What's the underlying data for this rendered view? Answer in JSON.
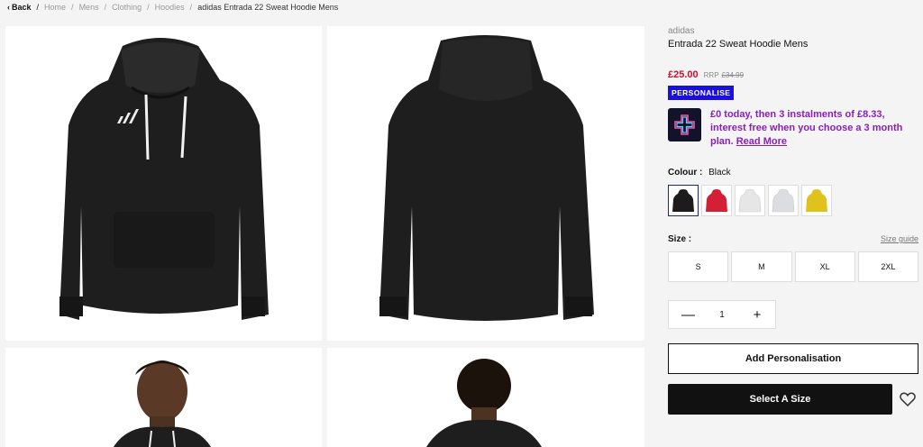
{
  "breadcrumb": {
    "back": "Back",
    "items": [
      "Home",
      "Mens",
      "Clothing",
      "Hoodies"
    ],
    "current": "adidas Entrada 22 Sweat Hoodie Mens"
  },
  "product": {
    "brand": "adidas",
    "name": "Entrada 22 Sweat Hoodie Mens",
    "price": "£25.00",
    "rrp_label": "RRP",
    "rrp_value": "£34.99",
    "personalise_badge": "PERSONALISE",
    "klarna_text": "£0 today, then 3 instalments of £8.33, interest free when you choose a 3 month plan.",
    "klarna_link": "Read More",
    "colour_label": "Colour :",
    "colour_value": "Black",
    "colours": [
      {
        "name": "black",
        "hex": "#1c1c1c"
      },
      {
        "name": "red",
        "hex": "#d32035"
      },
      {
        "name": "white",
        "hex": "#e8e8e8"
      },
      {
        "name": "light-grey",
        "hex": "#dcdde0"
      },
      {
        "name": "yellow",
        "hex": "#e0c21c"
      }
    ],
    "size_label": "Size :",
    "size_guide": "Size guide",
    "sizes": [
      "S",
      "M",
      "XL",
      "2XL"
    ],
    "quantity": "1",
    "qty_minus": "—",
    "qty_plus": "+",
    "add_personalisation": "Add Personalisation",
    "select_size": "Select A Size"
  },
  "colors": {
    "price": "#c8102e",
    "badge": "#1a10d8",
    "klarna_text": "#8a1fb8",
    "button": "#111111"
  }
}
